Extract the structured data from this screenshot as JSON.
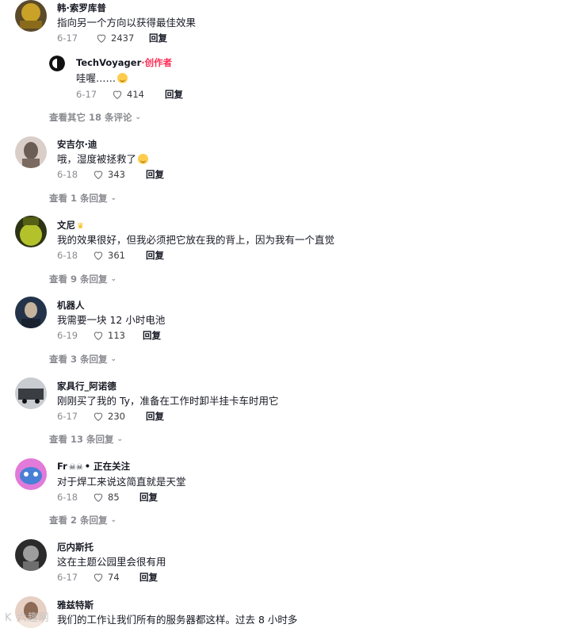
{
  "comments": [
    {
      "name": "韩·索罗库普",
      "text": "指向另一个方向以获得最佳效果",
      "date": "6-17",
      "likes": "2437",
      "reply": "回复",
      "avatar_colors": [
        "#c9a227",
        "#5b4a2a"
      ]
    },
    {
      "name": "安吉尔·迪",
      "text": "哦，湿度被拯救了",
      "date": "6-18",
      "likes": "343",
      "reply": "回复",
      "avatar_colors": [
        "#6b5d55",
        "#d9cfc8"
      ]
    },
    {
      "name": "文尼",
      "text": "我的效果很好，但我必须把它放在我的背上，因为我有一个直觉",
      "date": "6-18",
      "likes": "361",
      "reply": "回复",
      "avatar_colors": [
        "#b3c12b",
        "#2d3413"
      ]
    },
    {
      "name": "机器人",
      "text": "我需要一块 12 小时电池",
      "date": "6-19",
      "likes": "113",
      "reply": "回复",
      "avatar_colors": [
        "#23344a",
        "#c6b39b"
      ]
    },
    {
      "name": "家具行_阿诺德",
      "text": "刚刚买了我的 Ty，准备在工作时卸半挂卡车时用它",
      "date": "6-17",
      "likes": "230",
      "reply": "回复",
      "avatar_colors": [
        "#8a8f96",
        "#3a3d42"
      ]
    },
    {
      "name": "Fr",
      "status": "• 正在关注",
      "text": "对于焊工来说这简直就是天堂",
      "date": "6-18",
      "likes": "85",
      "reply": "回复",
      "avatar_colors": [
        "#e27ad9",
        "#4a7fd6"
      ]
    },
    {
      "name": "厄内斯托",
      "text": "这在主题公园里会很有用",
      "date": "6-17",
      "likes": "74",
      "reply": "回复",
      "avatar_colors": [
        "#2b2b2b",
        "#9e9e9e"
      ]
    },
    {
      "name": "雅兹特斯",
      "text": "我们的工作让我们所有的服务器都这样。过去 8 小时多",
      "avatar_colors": [
        "#e6d0c3",
        "#8c6a55"
      ]
    }
  ],
  "nested_reply": {
    "name": "TechVoyager",
    "creator_label": "·创作者",
    "text": "哇喔……",
    "date": "6-17",
    "likes": "414",
    "reply": "回复"
  },
  "view_more": [
    "查看其它 18 条评论",
    "查看 1 条回复",
    "查看 9 条回复",
    "查看 3 条回复",
    "查看 13 条回复",
    "查看 2 条回复"
  ],
  "watermark": "K 六趣网"
}
